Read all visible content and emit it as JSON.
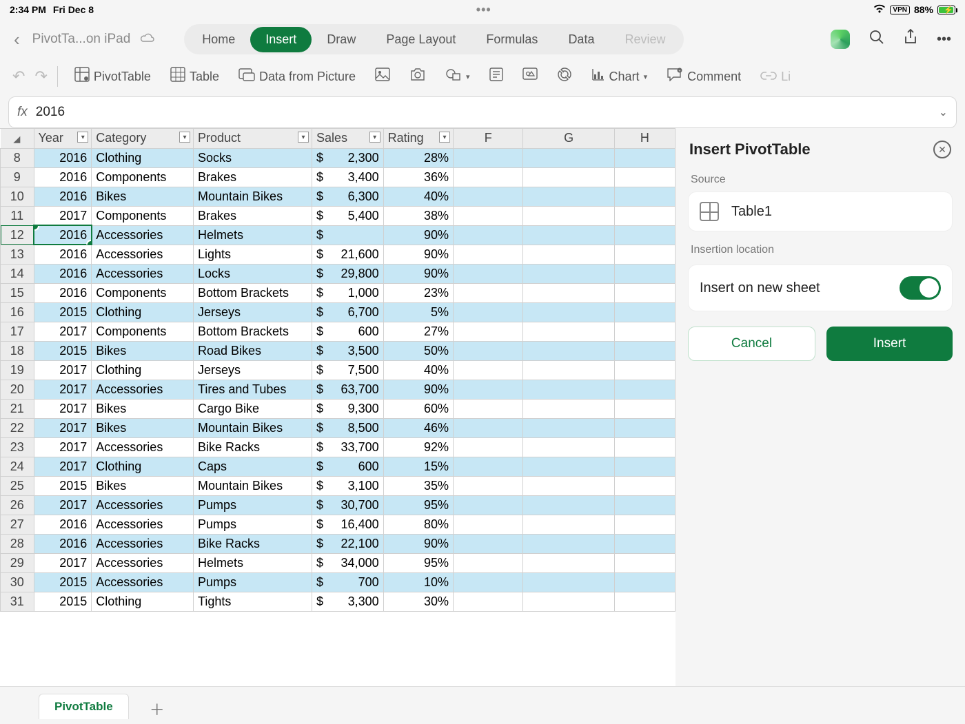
{
  "status": {
    "time": "2:34 PM",
    "date": "Fri Dec 8",
    "vpn": "VPN",
    "battery": "88%"
  },
  "title": {
    "doc": "PivotTa...on iPad"
  },
  "tabs": {
    "home": "Home",
    "insert": "Insert",
    "draw": "Draw",
    "page_layout": "Page Layout",
    "formulas": "Formulas",
    "data": "Data",
    "review": "Review"
  },
  "ribbon": {
    "pivottable": "PivotTable",
    "table": "Table",
    "data_from_picture": "Data from Picture",
    "chart": "Chart",
    "comment": "Comment",
    "link": "Li"
  },
  "formula": {
    "fx": "fx",
    "value": "2016"
  },
  "headers": {
    "year": "Year",
    "category": "Category",
    "product": "Product",
    "sales": "Sales",
    "rating": "Rating",
    "F": "F",
    "G": "G",
    "H": "H"
  },
  "selected_row": 12,
  "rows": [
    {
      "n": 8,
      "year": "2016",
      "category": "Clothing",
      "product": "Socks",
      "sales": "2,300",
      "rating": "28%"
    },
    {
      "n": 9,
      "year": "2016",
      "category": "Components",
      "product": "Brakes",
      "sales": "3,400",
      "rating": "36%"
    },
    {
      "n": 10,
      "year": "2016",
      "category": "Bikes",
      "product": "Mountain Bikes",
      "sales": "6,300",
      "rating": "40%"
    },
    {
      "n": 11,
      "year": "2017",
      "category": "Components",
      "product": "Brakes",
      "sales": "5,400",
      "rating": "38%"
    },
    {
      "n": 12,
      "year": "2016",
      "category": "Accessories",
      "product": "Helmets",
      "sales": "",
      "rating": "90%"
    },
    {
      "n": 13,
      "year": "2016",
      "category": "Accessories",
      "product": "Lights",
      "sales": "21,600",
      "rating": "90%"
    },
    {
      "n": 14,
      "year": "2016",
      "category": "Accessories",
      "product": "Locks",
      "sales": "29,800",
      "rating": "90%"
    },
    {
      "n": 15,
      "year": "2016",
      "category": "Components",
      "product": "Bottom Brackets",
      "sales": "1,000",
      "rating": "23%"
    },
    {
      "n": 16,
      "year": "2015",
      "category": "Clothing",
      "product": "Jerseys",
      "sales": "6,700",
      "rating": "5%"
    },
    {
      "n": 17,
      "year": "2017",
      "category": "Components",
      "product": "Bottom Brackets",
      "sales": "600",
      "rating": "27%"
    },
    {
      "n": 18,
      "year": "2015",
      "category": "Bikes",
      "product": "Road Bikes",
      "sales": "3,500",
      "rating": "50%"
    },
    {
      "n": 19,
      "year": "2017",
      "category": "Clothing",
      "product": "Jerseys",
      "sales": "7,500",
      "rating": "40%"
    },
    {
      "n": 20,
      "year": "2017",
      "category": "Accessories",
      "product": "Tires and Tubes",
      "sales": "63,700",
      "rating": "90%"
    },
    {
      "n": 21,
      "year": "2017",
      "category": "Bikes",
      "product": "Cargo Bike",
      "sales": "9,300",
      "rating": "60%"
    },
    {
      "n": 22,
      "year": "2017",
      "category": "Bikes",
      "product": "Mountain Bikes",
      "sales": "8,500",
      "rating": "46%"
    },
    {
      "n": 23,
      "year": "2017",
      "category": "Accessories",
      "product": "Bike Racks",
      "sales": "33,700",
      "rating": "92%"
    },
    {
      "n": 24,
      "year": "2017",
      "category": "Clothing",
      "product": "Caps",
      "sales": "600",
      "rating": "15%"
    },
    {
      "n": 25,
      "year": "2015",
      "category": "Bikes",
      "product": "Mountain Bikes",
      "sales": "3,100",
      "rating": "35%"
    },
    {
      "n": 26,
      "year": "2017",
      "category": "Accessories",
      "product": "Pumps",
      "sales": "30,700",
      "rating": "95%"
    },
    {
      "n": 27,
      "year": "2016",
      "category": "Accessories",
      "product": "Pumps",
      "sales": "16,400",
      "rating": "80%"
    },
    {
      "n": 28,
      "year": "2016",
      "category": "Accessories",
      "product": "Bike Racks",
      "sales": "22,100",
      "rating": "90%"
    },
    {
      "n": 29,
      "year": "2017",
      "category": "Accessories",
      "product": "Helmets",
      "sales": "34,000",
      "rating": "95%"
    },
    {
      "n": 30,
      "year": "2015",
      "category": "Accessories",
      "product": "Pumps",
      "sales": "700",
      "rating": "10%"
    },
    {
      "n": 31,
      "year": "2015",
      "category": "Clothing",
      "product": "Tights",
      "sales": "3,300",
      "rating": "30%"
    }
  ],
  "panel": {
    "title": "Insert PivotTable",
    "source_label": "Source",
    "source_name": "Table1",
    "location_label": "Insertion location",
    "toggle_label": "Insert on new sheet",
    "cancel": "Cancel",
    "insert": "Insert"
  },
  "sheet_tab": "PivotTable"
}
